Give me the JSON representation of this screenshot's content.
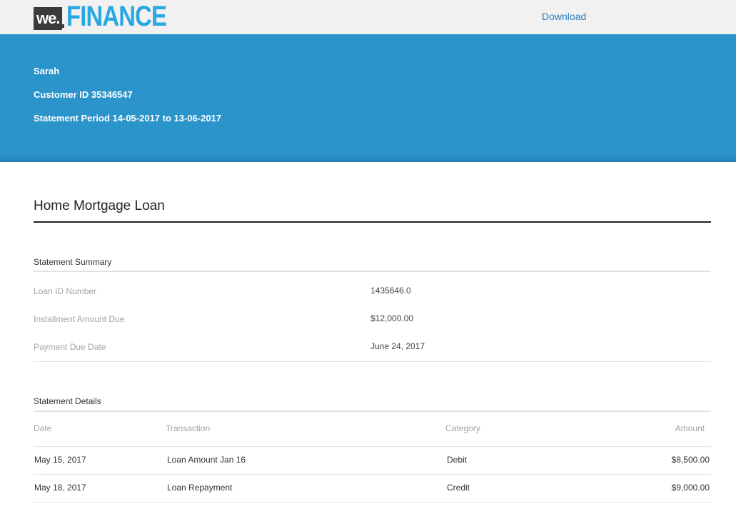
{
  "brand": {
    "we": "we.",
    "name": "FINANCE"
  },
  "nav": {
    "download_label": "Download"
  },
  "customer": {
    "name": "Sarah",
    "customer_id_line": "Customer ID 35346547",
    "period_line": "Statement Period 14-05-2017 to 13-06-2017"
  },
  "page": {
    "title": "Home Mortgage Loan"
  },
  "summary": {
    "heading": "Statement Summary",
    "rows": [
      {
        "label": "Loan ID Number",
        "value": "1435646.0"
      },
      {
        "label": "Installment Amount Due",
        "value": "$12,000.00"
      },
      {
        "label": "Payment Due Date",
        "value": "June 24, 2017"
      }
    ]
  },
  "details": {
    "heading": "Statement Details",
    "columns": {
      "date": "Date",
      "transaction": "Transaction",
      "category": "Category",
      "amount": "Amount"
    },
    "rows": [
      {
        "date": "May 15, 2017",
        "transaction": "Loan Amount Jan 16",
        "category": "Debit",
        "amount": "$8,500.00"
      },
      {
        "date": "May 18, 2017",
        "transaction": "Loan Repayment",
        "category": "Credit",
        "amount": "$9,000.00"
      }
    ]
  },
  "colors": {
    "brand_blue": "#29a7e1",
    "banner_blue": "#2b95cb",
    "link_blue": "#2d7fc0"
  }
}
